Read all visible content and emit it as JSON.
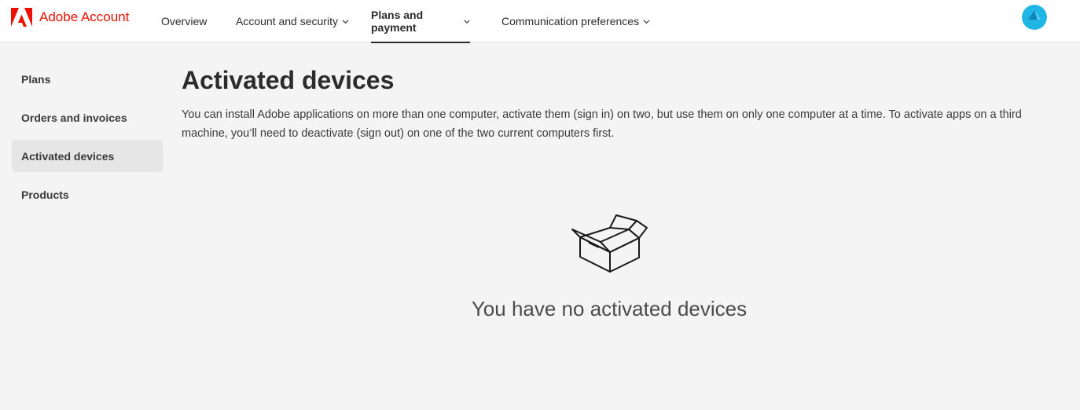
{
  "header": {
    "brand": "Adobe Account",
    "nav": [
      {
        "label": "Overview"
      },
      {
        "label": "Account and security"
      },
      {
        "label": "Plans and payment"
      },
      {
        "label": "Communication preferences"
      }
    ],
    "active_nav": "Plans and payment",
    "avatar_icon": "user-avatar-icon"
  },
  "sidebar": {
    "items": [
      {
        "label": "Plans"
      },
      {
        "label": "Orders and invoices"
      },
      {
        "label": "Activated devices"
      },
      {
        "label": "Products"
      }
    ],
    "selected": "Activated devices"
  },
  "main": {
    "title": "Activated devices",
    "description": "You can install Adobe applications on more than one computer, activate them (sign in) on two, but use them on only one computer at a time. To activate apps on a third machine, you’ll need to deactivate (sign out) on one of the two current computers first.",
    "empty_state": {
      "icon": "open-box-icon",
      "message": "You have no activated devices"
    }
  },
  "colors": {
    "brand_red": "#eb1000",
    "background": "#f4f4f4",
    "header_bg": "#ffffff",
    "selected_bg": "#e6e6e6",
    "avatar": "#1fb6e6"
  }
}
